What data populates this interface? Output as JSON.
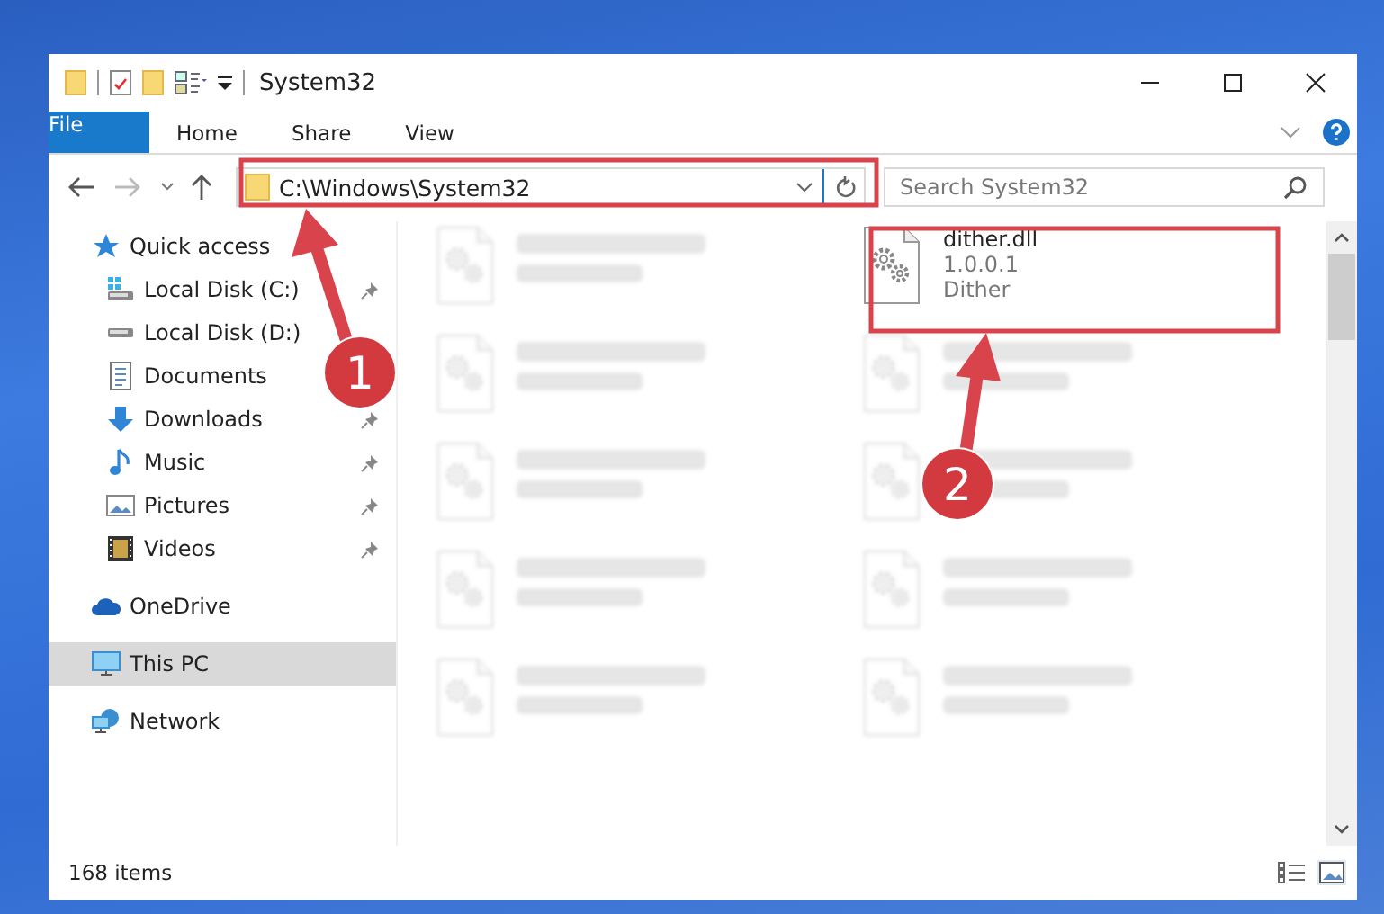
{
  "window": {
    "title": "System32"
  },
  "ribbon_tabs": [
    {
      "label": "File",
      "kind": "file"
    },
    {
      "label": "Home",
      "kind": "tab"
    },
    {
      "label": "Share",
      "kind": "tab"
    },
    {
      "label": "View",
      "kind": "tab"
    }
  ],
  "address_bar": {
    "path": "C:\\Windows\\System32"
  },
  "search": {
    "placeholder": "Search System32"
  },
  "sidebar": {
    "items": [
      {
        "label": "Quick access",
        "selected": false,
        "children": [
          {
            "label": "Local Disk (C:)",
            "pinned": true
          },
          {
            "label": "Local Disk (D:)",
            "pinned": false
          },
          {
            "label": "Documents",
            "pinned": false
          },
          {
            "label": "Downloads",
            "pinned": true
          },
          {
            "label": "Music",
            "pinned": true
          },
          {
            "label": "Pictures",
            "pinned": true
          },
          {
            "label": "Videos",
            "pinned": true
          }
        ]
      },
      {
        "label": "OneDrive",
        "selected": false
      },
      {
        "label": "This PC",
        "selected": true
      },
      {
        "label": "Network",
        "selected": false
      }
    ]
  },
  "files": [
    {
      "kind": "blurred"
    },
    {
      "kind": "file",
      "name": "dither.dll",
      "lines": [
        "1.0.0.1",
        "Dither"
      ]
    },
    {
      "kind": "blurred"
    },
    {
      "kind": "blurred"
    },
    {
      "kind": "blurred"
    },
    {
      "kind": "blurred"
    },
    {
      "kind": "blurred"
    },
    {
      "kind": "blurred"
    },
    {
      "kind": "blurred"
    },
    {
      "kind": "blurred"
    }
  ],
  "status_bar": {
    "text": "168 items"
  },
  "annotations": [
    {
      "number": "1"
    },
    {
      "number": "2"
    }
  ]
}
